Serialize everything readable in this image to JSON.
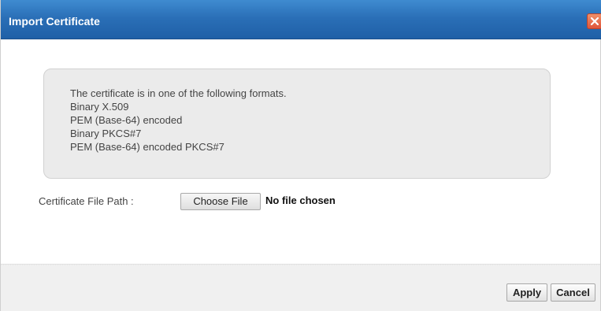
{
  "window": {
    "title": "Import Certificate",
    "close_icon": "close-icon"
  },
  "info": {
    "lines": [
      "The certificate is in one of the following formats.",
      "Binary X.509",
      "PEM (Base-64) encoded",
      "Binary PKCS#7",
      "PEM (Base-64) encoded PKCS#7"
    ]
  },
  "file_path": {
    "label": "Certificate File Path :",
    "choose_button": "Choose File",
    "status": "No file chosen"
  },
  "footer": {
    "apply_label": "Apply",
    "cancel_label": "Cancel"
  },
  "colors": {
    "titlebar": "#2a6fb7",
    "close_button": "#e0553a",
    "info_box_bg": "#ebebeb",
    "footer_bg": "#f0f0f0"
  }
}
